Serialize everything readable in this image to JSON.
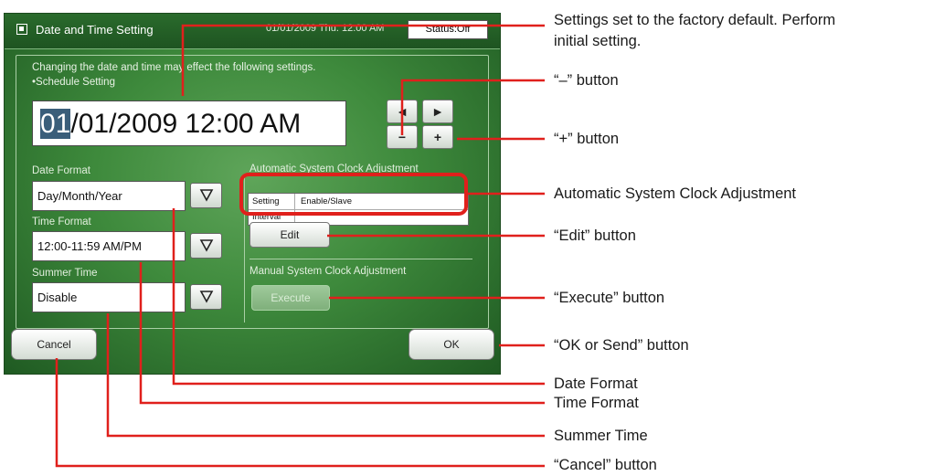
{
  "window": {
    "title": "Date and Time Setting",
    "title_datetime": "01/01/2009 Thu. 12:00 AM",
    "status": "Status:Off"
  },
  "notice": {
    "line1": "Changing the date and time may effect the following settings.",
    "line2": "•Schedule Setting"
  },
  "datetime": {
    "selected_part": "01",
    "rest": "/01/2009 12:00 AM"
  },
  "nav_buttons": {
    "left": "◄",
    "right": "►",
    "minus": "−",
    "plus": "+"
  },
  "date_format": {
    "label": "Date Format",
    "value": "Day/Month/Year"
  },
  "time_format": {
    "label": "Time Format",
    "value": "12:00-11:59 AM/PM"
  },
  "summer_time": {
    "label": "Summer Time",
    "value": "Disable"
  },
  "auto_adjust": {
    "label": "Automatic System Clock Adjustment",
    "rows": [
      {
        "key": "Setting",
        "value": "Enable/Slave"
      },
      {
        "key": "Interval",
        "value": ""
      }
    ],
    "edit_button": "Edit"
  },
  "manual_adjust": {
    "label": "Manual System Clock Adjustment",
    "execute_button": "Execute"
  },
  "footer": {
    "cancel": "Cancel",
    "ok": "OK"
  },
  "callouts": {
    "status": "Settings set to the factory default. Perform initial setting.",
    "status_line1": "Settings set to the factory default. Perform",
    "status_line2": "initial setting.",
    "minus": "“–” button",
    "plus": "“+” button",
    "auto_adjust": "Automatic System Clock Adjustment",
    "edit": "“Edit” button",
    "execute": "“Execute” button",
    "ok": "“OK or Send” button",
    "date_format": "Date Format",
    "time_format": "Time Format",
    "summer_time": "Summer Time",
    "cancel": "“Cancel” button"
  },
  "colors": {
    "panel_green": "#3e8a3c",
    "callout_red": "#e0201c",
    "selection_blue": "#3a5e7a"
  }
}
